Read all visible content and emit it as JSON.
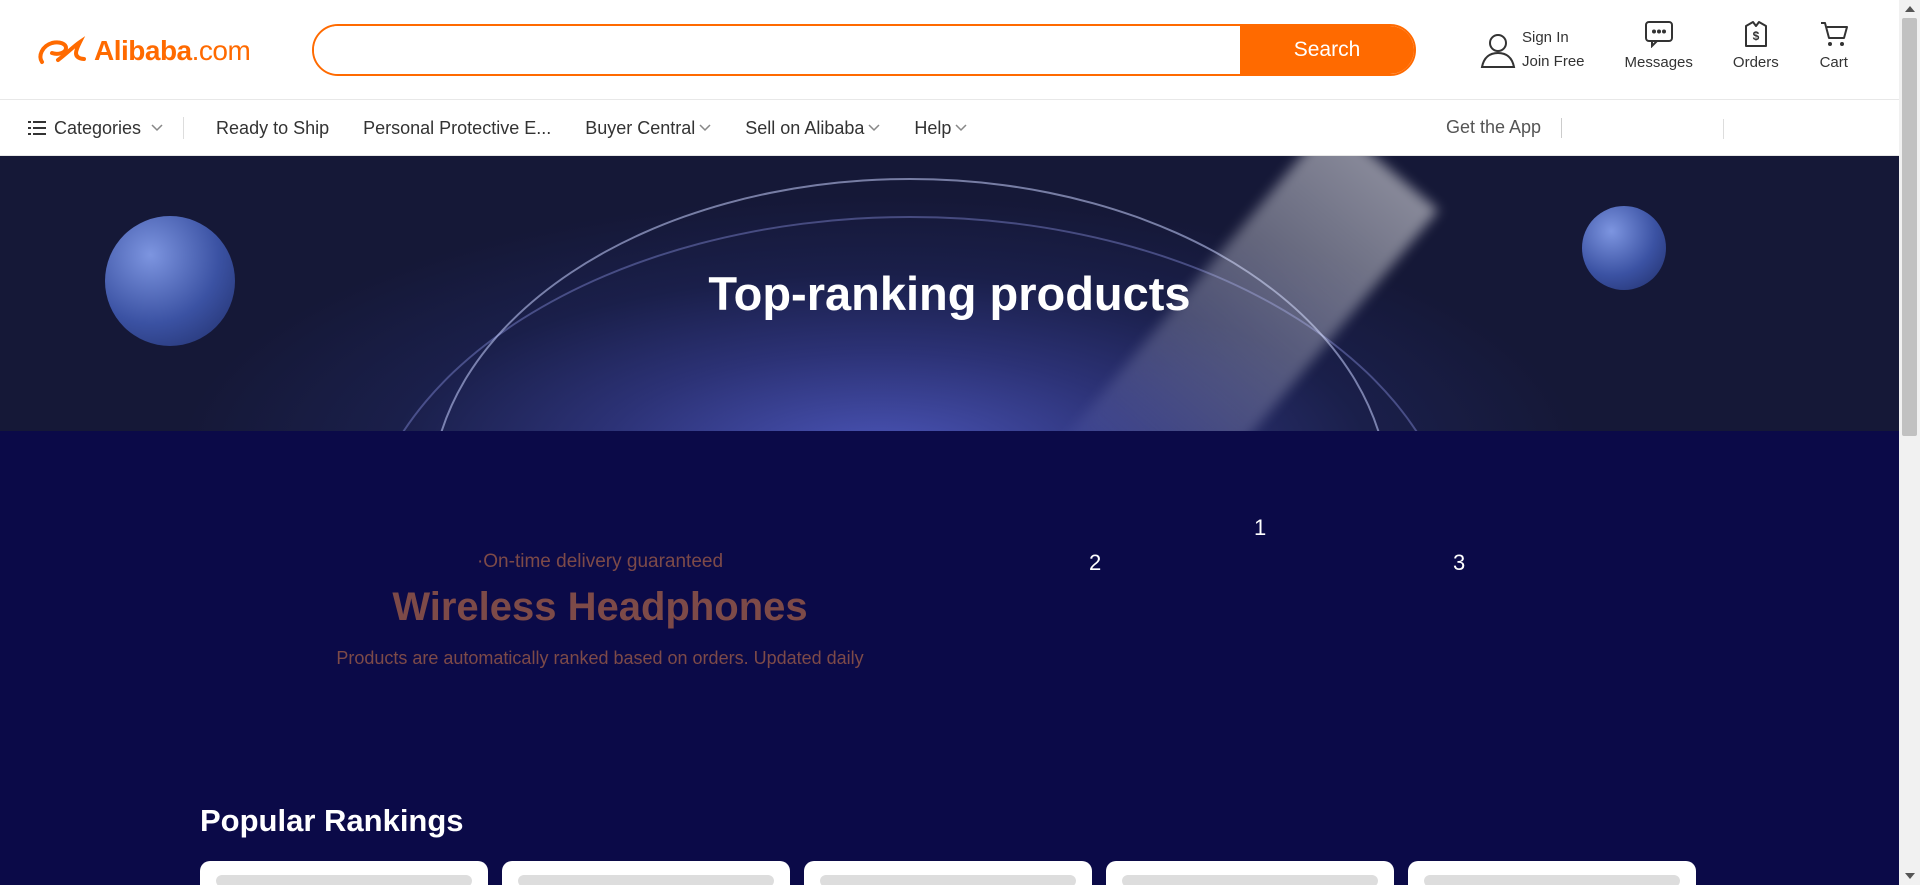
{
  "header": {
    "logo_brand": "Alibaba",
    "logo_suffix": ".com",
    "search": {
      "value": "",
      "placeholder": "",
      "button_label": "Search"
    },
    "sign_in": "Sign In",
    "join_free": "Join Free",
    "messages": "Messages",
    "orders": "Orders",
    "cart": "Cart"
  },
  "nav": {
    "categories": "Categories",
    "items": [
      {
        "label": "Ready to Ship"
      },
      {
        "label": "Personal Protective E..."
      },
      {
        "label": "Buyer Central"
      },
      {
        "label": "Sell on Alibaba"
      },
      {
        "label": "Help"
      }
    ],
    "get_app": "Get the App"
  },
  "hero": {
    "title": "Top-ranking products"
  },
  "feature": {
    "tag": "·On-time delivery guaranteed",
    "title": "Wireless Headphones",
    "subtitle": "Products are automatically ranked based on orders. Updated daily",
    "ranks": [
      "1",
      "2",
      "3"
    ]
  },
  "popular": {
    "title": "Popular Rankings",
    "card_count": 5
  },
  "colors": {
    "brand": "#ff6a00",
    "main_bg": "#0b0a48",
    "feature_text": "#7d4a48"
  }
}
